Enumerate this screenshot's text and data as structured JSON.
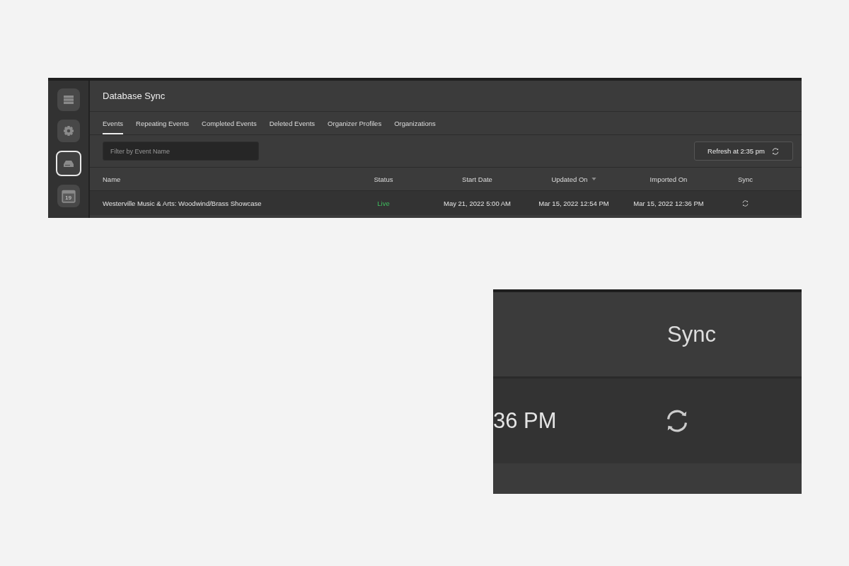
{
  "sidebar": {
    "items": [
      {
        "kind": "list",
        "selected": false
      },
      {
        "kind": "gear",
        "selected": false
      },
      {
        "kind": "drive",
        "selected": true
      },
      {
        "kind": "calendar",
        "selected": false,
        "label": "19"
      }
    ]
  },
  "header": {
    "title": "Database Sync"
  },
  "tabs": [
    {
      "label": "Events",
      "selected": true
    },
    {
      "label": "Repeating Events",
      "selected": false
    },
    {
      "label": "Completed Events",
      "selected": false
    },
    {
      "label": "Deleted Events",
      "selected": false
    },
    {
      "label": "Organizer Profiles",
      "selected": false
    },
    {
      "label": "Organizations",
      "selected": false
    }
  ],
  "filter": {
    "placeholder": "Filter by Event Name"
  },
  "refresh_button": {
    "label": "Refresh at 2:35 pm"
  },
  "table": {
    "columns": [
      {
        "label": "Name",
        "sorted": false
      },
      {
        "label": "Status",
        "sorted": false
      },
      {
        "label": "Start Date",
        "sorted": false
      },
      {
        "label": "Updated On",
        "sorted": true
      },
      {
        "label": "Imported On",
        "sorted": false
      },
      {
        "label": "Sync",
        "sorted": false
      }
    ],
    "rows": [
      {
        "name": "Westerville Music & Arts: Woodwind/Brass Showcase",
        "status": {
          "text": "Live",
          "color": "#3fbf5f"
        },
        "start_date": "May 21, 2022 5:00 AM",
        "updated_on": "Mar 15, 2022 12:54 PM",
        "imported_on": "Mar 15, 2022 12:36 PM"
      }
    ]
  },
  "inset": {
    "column_label": "Sync",
    "cell_text": "36 PM"
  }
}
